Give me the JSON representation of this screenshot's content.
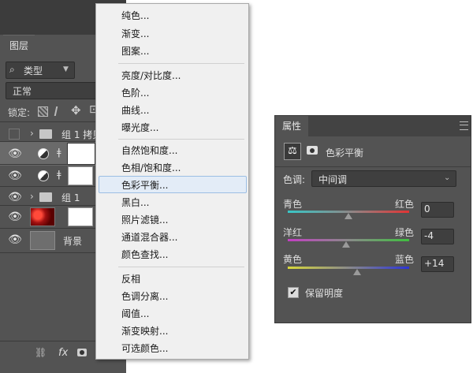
{
  "layers_panel": {
    "tab": "图层",
    "filter": {
      "icon": "search-icon",
      "label": "类型"
    },
    "blend_mode": "正常",
    "lock_label": "锁定:",
    "layers": [
      {
        "name": "组 1 拷贝",
        "type": "group",
        "visible": false
      },
      {
        "name": "",
        "type": "adjustment",
        "visible": true,
        "selected": true
      },
      {
        "name": "",
        "type": "adjustment",
        "visible": true
      },
      {
        "name": "组 1",
        "type": "group",
        "visible": true
      },
      {
        "name": "",
        "type": "image",
        "visible": true
      },
      {
        "name": "背景",
        "type": "background",
        "visible": true
      }
    ],
    "bottom_fx": "fx"
  },
  "adjustment_menu": {
    "groups": [
      [
        "纯色...",
        "渐变...",
        "图案..."
      ],
      [
        "亮度/对比度...",
        "色阶...",
        "曲线...",
        "曝光度..."
      ],
      [
        "自然饱和度...",
        "色相/饱和度...",
        "色彩平衡...",
        "黑白...",
        "照片滤镜...",
        "通道混合器...",
        "颜色查找..."
      ],
      [
        "反相",
        "色调分离...",
        "阈值...",
        "渐变映射...",
        "可选颜色..."
      ]
    ],
    "highlighted": "色彩平衡..."
  },
  "properties_panel": {
    "tab": "属性",
    "title": "色彩平衡",
    "tone_label": "色调:",
    "tone_value": "中间调",
    "sliders": [
      {
        "left": "青色",
        "right": "红色",
        "value": "0",
        "numeric": 0,
        "left_color": "#38c6c6",
        "right_color": "#e23434"
      },
      {
        "left": "洋红",
        "right": "绿色",
        "value": "-4",
        "numeric": -4,
        "left_color": "#c33fc3",
        "right_color": "#3fbf3f"
      },
      {
        "left": "黄色",
        "right": "蓝色",
        "value": "+14",
        "numeric": 14,
        "left_color": "#d8d83a",
        "right_color": "#2c34d6"
      }
    ],
    "preserve_luminosity": {
      "label": "保留明度",
      "checked": true
    }
  }
}
